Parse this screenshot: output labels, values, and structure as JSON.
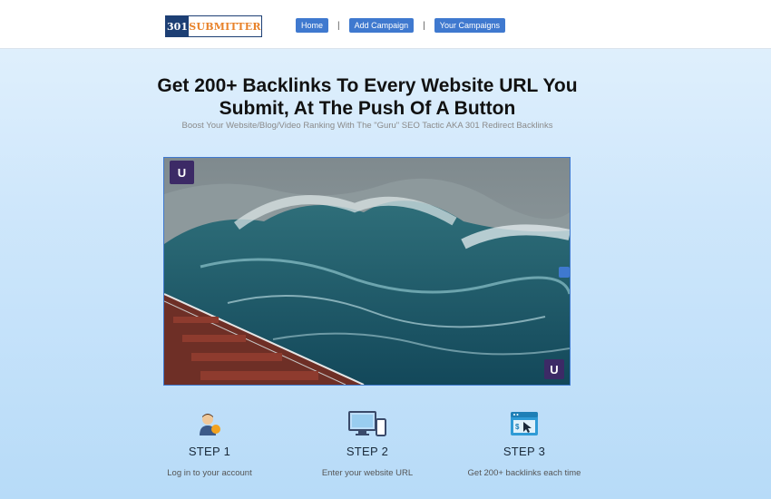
{
  "header": {
    "logo_number": "301",
    "logo_word": "SUBMITTER",
    "nav": [
      {
        "label": "Home"
      },
      {
        "label": "Add Campaign"
      },
      {
        "label": "Your Campaigns"
      }
    ],
    "separator": "|"
  },
  "hero": {
    "headline_line1": "Get 200+ Backlinks To Every Website URL You",
    "headline_line2": "Submit, At The Push Of A Button",
    "subheadline": "Boost Your Website/Blog/Video Ranking With The \"Guru\" SEO Tactic AKA 301 Redirect Backlinks"
  },
  "video": {
    "badge_letter": "U",
    "icons": [
      "channel-logo-icon",
      "picture-in-picture-icon",
      "watermark-icon"
    ]
  },
  "steps": [
    {
      "title": "STEP 1",
      "desc": "Log in to your account",
      "icon": "user-avatar-icon"
    },
    {
      "title": "STEP 2",
      "desc": "Enter your website URL",
      "icon": "devices-icon"
    },
    {
      "title": "STEP 3",
      "desc": "Get 200+ backlinks each time",
      "icon": "browser-click-icon"
    }
  ],
  "colors": {
    "brand_navy": "#1d3f74",
    "brand_orange": "#e8822a",
    "nav_blue": "#3f79cf",
    "icon_blue": "#2f9bd6"
  }
}
